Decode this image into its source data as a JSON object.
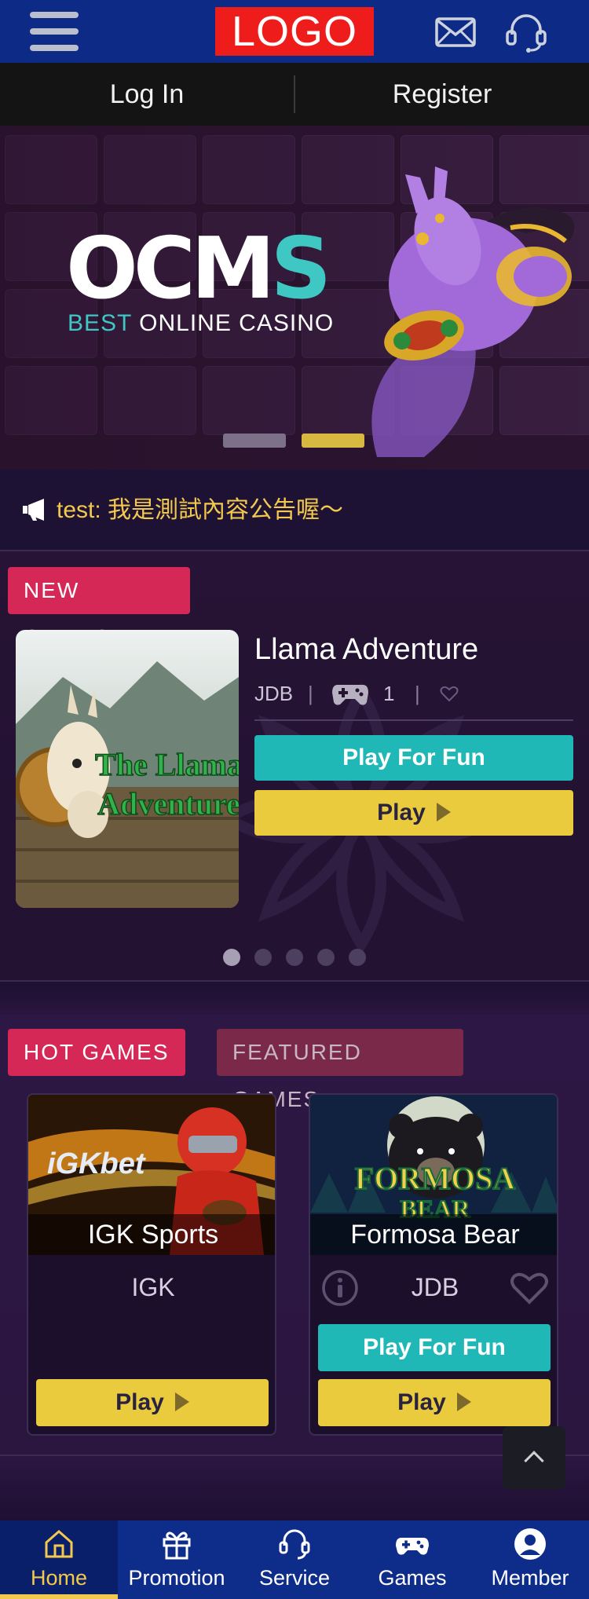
{
  "header": {
    "logo_text": "LOGO",
    "menu_icon": "hamburger-menu-icon",
    "mail_icon": "mail-icon",
    "support_icon": "headset-icon"
  },
  "auth": {
    "login_label": "Log In",
    "register_label": "Register"
  },
  "banner": {
    "brand_main": "OCM",
    "brand_accent": "S",
    "tagline_accent": "BEST",
    "tagline_rest": " ONLINE CASINO",
    "slide_count": 2,
    "active_slide": 2
  },
  "announcement": {
    "icon": "megaphone-icon",
    "text": "test:  我是測試內容公告喔～"
  },
  "new_games": {
    "section_label": "NEW GAMES",
    "game": {
      "title": "Llama Adventure",
      "provider": "JDB",
      "players": "1",
      "thumbnail_text": "The Llama Adventure",
      "fun_label": "Play For Fun",
      "play_label": "Play"
    },
    "page_count": 5,
    "active_page": 1
  },
  "hot_games": {
    "tab_hot": "HOT GAMES",
    "tab_featured": "FEATURED GAMES",
    "cards": [
      {
        "name": "IGK Sports",
        "provider": "IGK",
        "image_text": "iGKbet",
        "play_label": "Play"
      },
      {
        "name": "Formosa Bear",
        "provider": "JDB",
        "image_text": "FORMOSA BEAR",
        "fun_label": "Play For Fun",
        "play_label": "Play"
      }
    ]
  },
  "bottom_nav": {
    "items": [
      {
        "label": "Home",
        "icon": "home-icon",
        "active": true
      },
      {
        "label": "Promotion",
        "icon": "gift-icon",
        "active": false
      },
      {
        "label": "Service",
        "icon": "headset-icon",
        "active": false
      },
      {
        "label": "Games",
        "icon": "gamepad-icon",
        "active": false
      },
      {
        "label": "Member",
        "icon": "user-icon",
        "active": false
      }
    ]
  },
  "colors": {
    "header_blue": "#0d2a86",
    "accent_pink": "#d62857",
    "accent_teal": "#20b8b6",
    "accent_yellow": "#ebcb3e",
    "announcement_text": "#f2c94c"
  }
}
